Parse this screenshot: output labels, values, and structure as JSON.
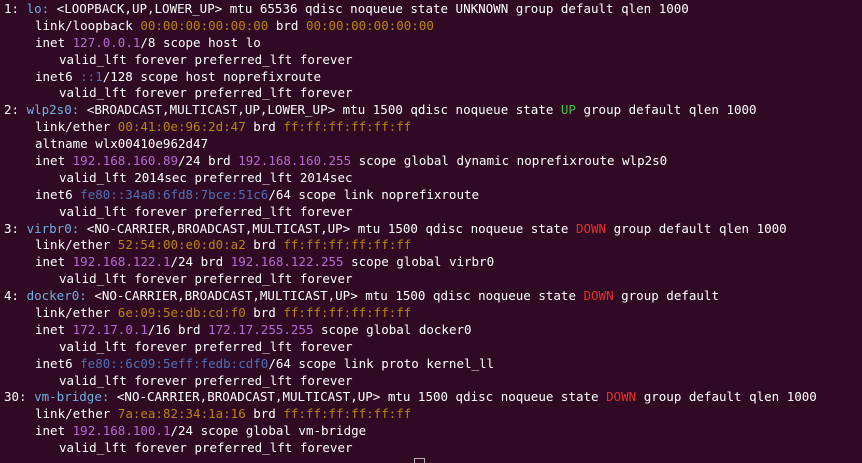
{
  "colors": {
    "background": "#300a24",
    "default": "#ffffff",
    "iface": "#6fb0de",
    "mac": "#b8860b",
    "ip4": "#b66ad6",
    "ip6": "#4f6fb5",
    "up": "#3cc040",
    "down": "#e03030"
  },
  "lines": [
    {
      "indent": 0,
      "segs": [
        {
          "t": "1: ",
          "c": "default"
        },
        {
          "t": "lo:",
          "c": "iface"
        },
        {
          "t": " <LOOPBACK,UP,LOWER_UP> mtu 65536 qdisc noqueue state UNKNOWN group default qlen 1000",
          "c": "default"
        }
      ]
    },
    {
      "indent": 1,
      "segs": [
        {
          "t": "link/loopback ",
          "c": "default"
        },
        {
          "t": "00:00:00:00:00:00",
          "c": "mac"
        },
        {
          "t": " brd ",
          "c": "default"
        },
        {
          "t": "00:00:00:00:00:00",
          "c": "mac"
        }
      ]
    },
    {
      "indent": 1,
      "segs": [
        {
          "t": "inet ",
          "c": "default"
        },
        {
          "t": "127.0.0.1",
          "c": "ip4"
        },
        {
          "t": "/8 scope host lo",
          "c": "default"
        }
      ]
    },
    {
      "indent": 2,
      "segs": [
        {
          "t": "valid_lft forever preferred_lft forever",
          "c": "default"
        }
      ]
    },
    {
      "indent": 1,
      "segs": [
        {
          "t": "inet6 ",
          "c": "default"
        },
        {
          "t": "::1",
          "c": "ip6"
        },
        {
          "t": "/128 scope host noprefixroute",
          "c": "default"
        }
      ]
    },
    {
      "indent": 2,
      "segs": [
        {
          "t": "valid_lft forever preferred_lft forever",
          "c": "default"
        }
      ]
    },
    {
      "indent": 0,
      "segs": [
        {
          "t": "2: ",
          "c": "default"
        },
        {
          "t": "wlp2s0:",
          "c": "iface"
        },
        {
          "t": " <BROADCAST,MULTICAST,UP,LOWER_UP> mtu 1500 qdisc noqueue state ",
          "c": "default"
        },
        {
          "t": "UP",
          "c": "up"
        },
        {
          "t": " group default qlen 1000",
          "c": "default"
        }
      ]
    },
    {
      "indent": 1,
      "segs": [
        {
          "t": "link/ether ",
          "c": "default"
        },
        {
          "t": "00:41:0e:96:2d:47",
          "c": "mac"
        },
        {
          "t": " brd ",
          "c": "default"
        },
        {
          "t": "ff:ff:ff:ff:ff:ff",
          "c": "mac"
        }
      ]
    },
    {
      "indent": 1,
      "segs": [
        {
          "t": "altname wlx00410e962d47",
          "c": "default"
        }
      ]
    },
    {
      "indent": 1,
      "segs": [
        {
          "t": "inet ",
          "c": "default"
        },
        {
          "t": "192.168.160.89",
          "c": "ip4"
        },
        {
          "t": "/24 brd ",
          "c": "default"
        },
        {
          "t": "192.168.160.255",
          "c": "ip4"
        },
        {
          "t": " scope global dynamic noprefixroute wlp2s0",
          "c": "default"
        }
      ]
    },
    {
      "indent": 2,
      "segs": [
        {
          "t": "valid_lft 2014sec preferred_lft 2014sec",
          "c": "default"
        }
      ]
    },
    {
      "indent": 1,
      "segs": [
        {
          "t": "inet6 ",
          "c": "default"
        },
        {
          "t": "fe80::34a8:6fd8:7bce:51c6",
          "c": "ip6"
        },
        {
          "t": "/64 scope link noprefixroute",
          "c": "default"
        }
      ]
    },
    {
      "indent": 2,
      "segs": [
        {
          "t": "valid_lft forever preferred_lft forever",
          "c": "default"
        }
      ]
    },
    {
      "indent": 0,
      "segs": [
        {
          "t": "3: ",
          "c": "default"
        },
        {
          "t": "virbr0:",
          "c": "iface"
        },
        {
          "t": " <NO-CARRIER,BROADCAST,MULTICAST,UP> mtu 1500 qdisc noqueue state ",
          "c": "default"
        },
        {
          "t": "DOWN",
          "c": "down"
        },
        {
          "t": " group default qlen 1000",
          "c": "default"
        }
      ]
    },
    {
      "indent": 1,
      "segs": [
        {
          "t": "link/ether ",
          "c": "default"
        },
        {
          "t": "52:54:00:e0:d0:a2",
          "c": "mac"
        },
        {
          "t": " brd ",
          "c": "default"
        },
        {
          "t": "ff:ff:ff:ff:ff:ff",
          "c": "mac"
        }
      ]
    },
    {
      "indent": 1,
      "segs": [
        {
          "t": "inet ",
          "c": "default"
        },
        {
          "t": "192.168.122.1",
          "c": "ip4"
        },
        {
          "t": "/24 brd ",
          "c": "default"
        },
        {
          "t": "192.168.122.255",
          "c": "ip4"
        },
        {
          "t": " scope global virbr0",
          "c": "default"
        }
      ]
    },
    {
      "indent": 2,
      "segs": [
        {
          "t": "valid_lft forever preferred_lft forever",
          "c": "default"
        }
      ]
    },
    {
      "indent": 0,
      "segs": [
        {
          "t": "4: ",
          "c": "default"
        },
        {
          "t": "docker0:",
          "c": "iface"
        },
        {
          "t": " <NO-CARRIER,BROADCAST,MULTICAST,UP> mtu 1500 qdisc noqueue state ",
          "c": "default"
        },
        {
          "t": "DOWN",
          "c": "down"
        },
        {
          "t": " group default",
          "c": "default"
        }
      ]
    },
    {
      "indent": 1,
      "segs": [
        {
          "t": "link/ether ",
          "c": "default"
        },
        {
          "t": "6e:09:5e:db:cd:f0",
          "c": "mac"
        },
        {
          "t": " brd ",
          "c": "default"
        },
        {
          "t": "ff:ff:ff:ff:ff:ff",
          "c": "mac"
        }
      ]
    },
    {
      "indent": 1,
      "segs": [
        {
          "t": "inet ",
          "c": "default"
        },
        {
          "t": "172.17.0.1",
          "c": "ip4"
        },
        {
          "t": "/16 brd ",
          "c": "default"
        },
        {
          "t": "172.17.255.255",
          "c": "ip4"
        },
        {
          "t": " scope global docker0",
          "c": "default"
        }
      ]
    },
    {
      "indent": 2,
      "segs": [
        {
          "t": "valid_lft forever preferred_lft forever",
          "c": "default"
        }
      ]
    },
    {
      "indent": 1,
      "segs": [
        {
          "t": "inet6 ",
          "c": "default"
        },
        {
          "t": "fe80::6c09:5eff:fedb:cdf0",
          "c": "ip6"
        },
        {
          "t": "/64 scope link proto kernel_ll",
          "c": "default"
        }
      ]
    },
    {
      "indent": 2,
      "segs": [
        {
          "t": "valid_lft forever preferred_lft forever",
          "c": "default"
        }
      ]
    },
    {
      "indent": 0,
      "segs": [
        {
          "t": "30: ",
          "c": "default"
        },
        {
          "t": "vm-bridge:",
          "c": "iface"
        },
        {
          "t": " <NO-CARRIER,BROADCAST,MULTICAST,UP> mtu 1500 qdisc noqueue state ",
          "c": "default"
        },
        {
          "t": "DOWN",
          "c": "down"
        },
        {
          "t": " group default qlen 1000",
          "c": "default"
        }
      ]
    },
    {
      "indent": 1,
      "segs": [
        {
          "t": "link/ether ",
          "c": "default"
        },
        {
          "t": "7a:ea:82:34:1a:16",
          "c": "mac"
        },
        {
          "t": " brd ",
          "c": "default"
        },
        {
          "t": "ff:ff:ff:ff:ff:ff",
          "c": "mac"
        }
      ]
    },
    {
      "indent": 1,
      "segs": [
        {
          "t": "inet ",
          "c": "default"
        },
        {
          "t": "192.168.100.1",
          "c": "ip4"
        },
        {
          "t": "/24 scope global vm-bridge",
          "c": "default"
        }
      ]
    },
    {
      "indent": 2,
      "segs": [
        {
          "t": "valid_lft forever preferred_lft forever",
          "c": "default"
        }
      ]
    }
  ]
}
